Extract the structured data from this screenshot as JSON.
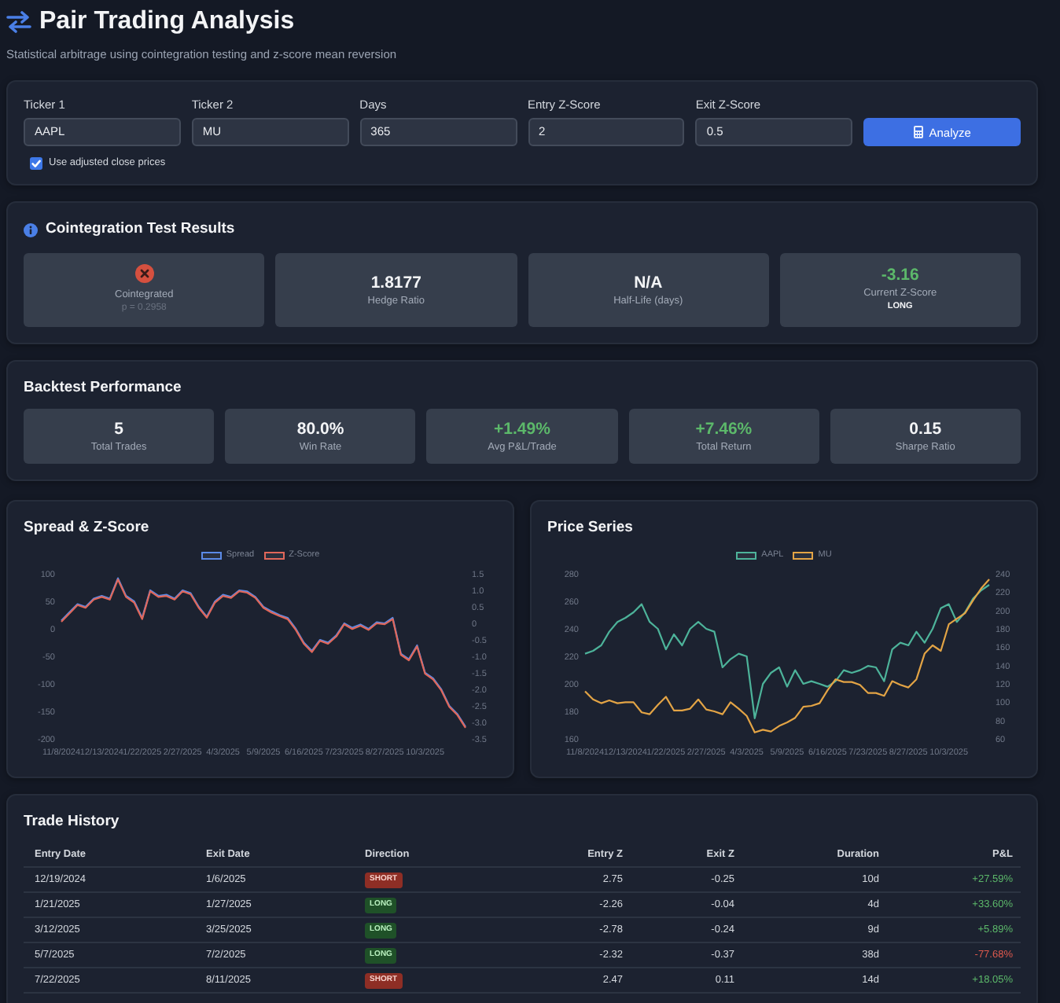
{
  "header": {
    "title": "Pair Trading Analysis",
    "subtitle": "Statistical arbitrage using cointegration testing and z-score mean reversion"
  },
  "form": {
    "fields": [
      {
        "label": "Ticker 1",
        "value": "AAPL"
      },
      {
        "label": "Ticker 2",
        "value": "MU"
      },
      {
        "label": "Days",
        "value": "365"
      },
      {
        "label": "Entry Z-Score",
        "value": "2"
      },
      {
        "label": "Exit Z-Score",
        "value": "0.5"
      }
    ],
    "button": "Analyze",
    "option": {
      "label": "Use adjusted close prices",
      "checked": true
    }
  },
  "cointegration": {
    "title": "Cointegration Test Results",
    "tiles": [
      {
        "kind": "status",
        "passed": false,
        "label": "Cointegrated",
        "note": "p = 0.2958"
      },
      {
        "kind": "value",
        "value": "1.8177",
        "color": "#f3f4f6",
        "label": "Hedge Ratio"
      },
      {
        "kind": "value",
        "value": "N/A",
        "color": "#f3f4f6",
        "label": "Half-Life (days)"
      },
      {
        "kind": "value",
        "value": "-3.16",
        "color": "#5cb86a",
        "label": "Current Z-Score",
        "note": "LONG"
      }
    ]
  },
  "backtest": {
    "title": "Backtest Performance",
    "tiles": [
      {
        "value": "5",
        "color": "#f3f4f6",
        "label": "Total Trades"
      },
      {
        "value": "80.0%",
        "color": "#f3f4f6",
        "label": "Win Rate"
      },
      {
        "value": "+1.49%",
        "color": "#5cb86a",
        "label": "Avg P&L/Trade"
      },
      {
        "value": "+7.46%",
        "color": "#5cb86a",
        "label": "Total Return"
      },
      {
        "value": "0.15",
        "color": "#f3f4f6",
        "label": "Sharpe Ratio"
      }
    ]
  },
  "charts": [
    {
      "title": "Spread & Z-Score",
      "chart_data": {
        "type": "line",
        "legend": "top",
        "categories": [
          "11/8/2024",
          null,
          null,
          null,
          null,
          "12/13/2024",
          null,
          null,
          null,
          null,
          "1/22/2025",
          null,
          null,
          null,
          null,
          "2/27/2025",
          null,
          null,
          null,
          null,
          "4/3/2025",
          null,
          null,
          null,
          null,
          "5/9/2025",
          null,
          null,
          null,
          null,
          "6/16/2025",
          null,
          null,
          null,
          null,
          "7/23/2025",
          null,
          null,
          null,
          null,
          "8/27/2025",
          null,
          null,
          null,
          null,
          "10/3/2025",
          null,
          null,
          null,
          null,
          null
        ],
        "ylim": [
          -200,
          100
        ],
        "yticks": [
          -200,
          -150,
          -100,
          -50,
          0,
          50,
          100
        ],
        "y2lim": [
          -3.5,
          1.5
        ],
        "y2ticks": [
          -3.5,
          {
            "value": -3,
            "label": "-3.0"
          },
          -2.5,
          {
            "value": -2,
            "label": "-2.0"
          },
          -1.5,
          {
            "value": -1,
            "label": "-1.0"
          },
          -0.5,
          0,
          0.5,
          {
            "value": 1,
            "label": "1.0"
          },
          1.5
        ],
        "series": [
          {
            "name": "Spread",
            "color": "#5b8ae6",
            "values": [
              15,
              30,
              45,
              40,
              55,
              60,
              55,
              92,
              60,
              50,
              20,
              70,
              60,
              62,
              55,
              70,
              65,
              40,
              22,
              50,
              62,
              58,
              70,
              68,
              58,
              40,
              32,
              25,
              20,
              0,
              -25,
              -40,
              -20,
              -25,
              -12,
              10,
              2,
              8,
              0,
              12,
              10,
              20,
              -45,
              -55,
              -30,
              -80,
              -90,
              -110,
              -140,
              -155,
              -178
            ]
          },
          {
            "name": "Z-Score",
            "color": "#e0675a",
            "axis": "y2",
            "values": [
              0.05,
              0.3,
              0.55,
              0.47,
              0.72,
              0.8,
              0.72,
              1.33,
              0.8,
              0.63,
              0.13,
              0.97,
              0.8,
              0.83,
              0.72,
              0.97,
              0.88,
              0.47,
              0.17,
              0.63,
              0.83,
              0.77,
              0.97,
              0.93,
              0.77,
              0.47,
              0.33,
              0.22,
              0.13,
              -0.2,
              -0.62,
              -0.87,
              -0.53,
              -0.62,
              -0.4,
              -0.03,
              -0.17,
              -0.07,
              -0.2,
              0,
              -0.03,
              0.13,
              -0.95,
              -1.12,
              -0.7,
              -1.53,
              -1.7,
              -2.03,
              -2.53,
              -2.78,
              -3.16
            ]
          }
        ]
      }
    },
    {
      "title": "Price Series",
      "chart_data": {
        "type": "line",
        "legend": "top",
        "categories": [
          "11/8/2024",
          null,
          null,
          null,
          null,
          "12/13/2024",
          null,
          null,
          null,
          null,
          "1/22/2025",
          null,
          null,
          null,
          null,
          "2/27/2025",
          null,
          null,
          null,
          null,
          "4/3/2025",
          null,
          null,
          null,
          null,
          "5/9/2025",
          null,
          null,
          null,
          null,
          "6/16/2025",
          null,
          null,
          null,
          null,
          "7/23/2025",
          null,
          null,
          null,
          null,
          "8/27/2025",
          null,
          null,
          null,
          null,
          "10/3/2025",
          null,
          null,
          null,
          null,
          null
        ],
        "ylim": [
          160,
          280
        ],
        "yticks": [
          160,
          180,
          200,
          220,
          240,
          260,
          280
        ],
        "y2lim": [
          60,
          240
        ],
        "y2ticks": [
          60,
          80,
          100,
          120,
          140,
          160,
          180,
          200,
          220,
          240
        ],
        "series": [
          {
            "name": "AAPL",
            "color": "#4db39a",
            "values": [
              222,
              224,
              228,
              238,
              245,
              248,
              252,
              258,
              245,
              240,
              225,
              236,
              228,
              240,
              245,
              240,
              238,
              212,
              218,
              222,
              220,
              175,
              200,
              208,
              212,
              198,
              210,
              200,
              202,
              200,
              198,
              202,
              210,
              208,
              210,
              213,
              212,
              202,
              225,
              230,
              228,
              238,
              230,
              240,
              255,
              258,
              245,
              252,
              262,
              268,
              272
            ]
          },
          {
            "name": "MU",
            "color": "#e3a445",
            "axis": "y2",
            "values": [
              112,
              103,
              99,
              102,
              99,
              100,
              100,
              89,
              87,
              97,
              106,
              91,
              91,
              93,
              103,
              92,
              90,
              87,
              100,
              93,
              85,
              67,
              70,
              68,
              74,
              78,
              83,
              95,
              96,
              99,
              113,
              125,
              122,
              122,
              119,
              110,
              110,
              107,
              123,
              119,
              116,
              125,
              153,
              162,
              156,
              185,
              191,
              197,
              211,
              224,
              234
            ]
          }
        ]
      }
    }
  ],
  "trade_history": {
    "title": "Trade History",
    "columns": [
      "Entry Date",
      "Exit Date",
      "Direction",
      "Entry Z",
      "Exit Z",
      "Duration",
      "P&L"
    ],
    "rows": [
      {
        "entry_date": "12/19/2024",
        "exit_date": "1/6/2025",
        "direction": {
          "label": "SHORT",
          "kind": "short"
        },
        "entry_z": "2.75",
        "exit_z": "-0.25",
        "duration": "10d",
        "pnl": {
          "text": "+27.59%",
          "kind": "gain"
        }
      },
      {
        "entry_date": "1/21/2025",
        "exit_date": "1/27/2025",
        "direction": {
          "label": "LONG",
          "kind": "long"
        },
        "entry_z": "-2.26",
        "exit_z": "-0.04",
        "duration": "4d",
        "pnl": {
          "text": "+33.60%",
          "kind": "gain"
        }
      },
      {
        "entry_date": "3/12/2025",
        "exit_date": "3/25/2025",
        "direction": {
          "label": "LONG",
          "kind": "long"
        },
        "entry_z": "-2.78",
        "exit_z": "-0.24",
        "duration": "9d",
        "pnl": {
          "text": "+5.89%",
          "kind": "gain"
        }
      },
      {
        "entry_date": "5/7/2025",
        "exit_date": "7/2/2025",
        "direction": {
          "label": "LONG",
          "kind": "long"
        },
        "entry_z": "-2.32",
        "exit_z": "-0.37",
        "duration": "38d",
        "pnl": {
          "text": "-77.68%",
          "kind": "loss"
        }
      },
      {
        "entry_date": "7/22/2025",
        "exit_date": "8/11/2025",
        "direction": {
          "label": "SHORT",
          "kind": "short"
        },
        "entry_z": "2.47",
        "exit_z": "0.11",
        "duration": "14d",
        "pnl": {
          "text": "+18.05%",
          "kind": "gain"
        }
      }
    ]
  }
}
